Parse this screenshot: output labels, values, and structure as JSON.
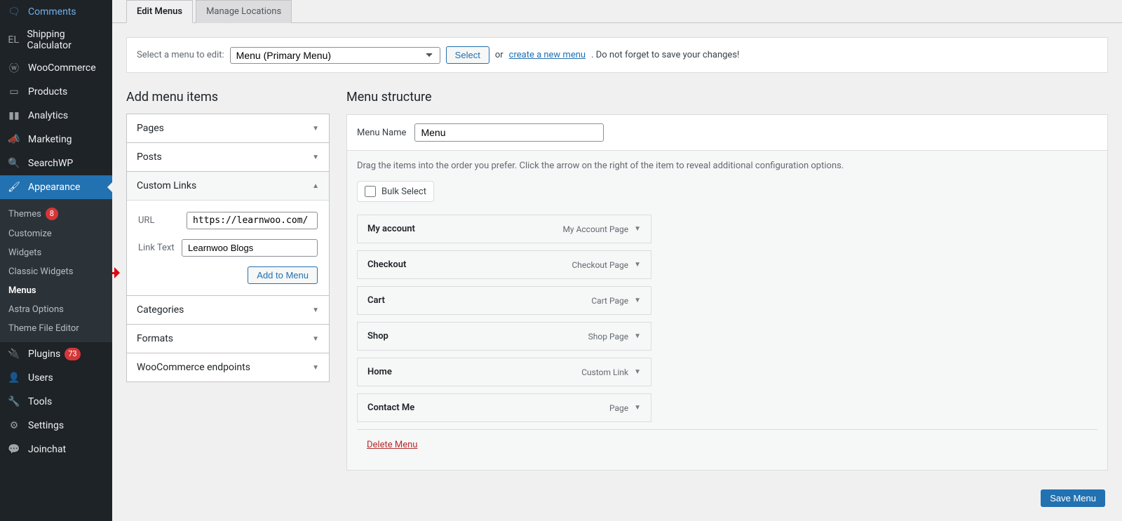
{
  "sidebar": {
    "items": [
      {
        "label": "Comments",
        "icon": "comment"
      },
      {
        "label": "Shipping Calculator",
        "icon": "calc"
      },
      {
        "label": "WooCommerce",
        "icon": "woo"
      },
      {
        "label": "Products",
        "icon": "archive"
      },
      {
        "label": "Analytics",
        "icon": "chart"
      },
      {
        "label": "Marketing",
        "icon": "megaphone"
      },
      {
        "label": "SearchWP",
        "icon": "search"
      },
      {
        "label": "Appearance",
        "icon": "brush",
        "active": true
      },
      {
        "label": "Plugins",
        "icon": "plug",
        "badge": "73"
      },
      {
        "label": "Users",
        "icon": "user"
      },
      {
        "label": "Tools",
        "icon": "wrench"
      },
      {
        "label": "Settings",
        "icon": "sliders"
      },
      {
        "label": "Joinchat",
        "icon": "chat"
      }
    ],
    "submenu": [
      {
        "label": "Themes",
        "badge": "8"
      },
      {
        "label": "Customize"
      },
      {
        "label": "Widgets"
      },
      {
        "label": "Classic Widgets"
      },
      {
        "label": "Menus",
        "current": true
      },
      {
        "label": "Astra Options"
      },
      {
        "label": "Theme File Editor"
      }
    ]
  },
  "tabs": {
    "edit": "Edit Menus",
    "manage": "Manage Locations"
  },
  "selectbar": {
    "label": "Select a menu to edit:",
    "option": "Menu (Primary Menu)",
    "select_btn": "Select",
    "or": "or",
    "create_link": "create a new menu",
    "tail": ". Do not forget to save your changes!"
  },
  "left": {
    "title": "Add menu items",
    "acc": [
      "Pages",
      "Posts",
      "Custom Links",
      "Categories",
      "Formats",
      "WooCommerce endpoints"
    ],
    "custom": {
      "url_label": "URL",
      "url_value": "https://learnwoo.com/",
      "text_label": "Link Text",
      "text_value": "Learnwoo Blogs",
      "add_btn": "Add to Menu"
    }
  },
  "right": {
    "title": "Menu structure",
    "name_label": "Menu Name",
    "name_value": "Menu",
    "hint": "Drag the items into the order you prefer. Click the arrow on the right of the item to reveal additional configuration options.",
    "bulk": "Bulk Select",
    "items": [
      {
        "title": "My account",
        "type": "My Account Page"
      },
      {
        "title": "Checkout",
        "type": "Checkout Page"
      },
      {
        "title": "Cart",
        "type": "Cart Page"
      },
      {
        "title": "Shop",
        "type": "Shop Page"
      },
      {
        "title": "Home",
        "type": "Custom Link"
      },
      {
        "title": "Contact Me",
        "type": "Page"
      }
    ],
    "delete": "Delete Menu",
    "save": "Save Menu"
  }
}
